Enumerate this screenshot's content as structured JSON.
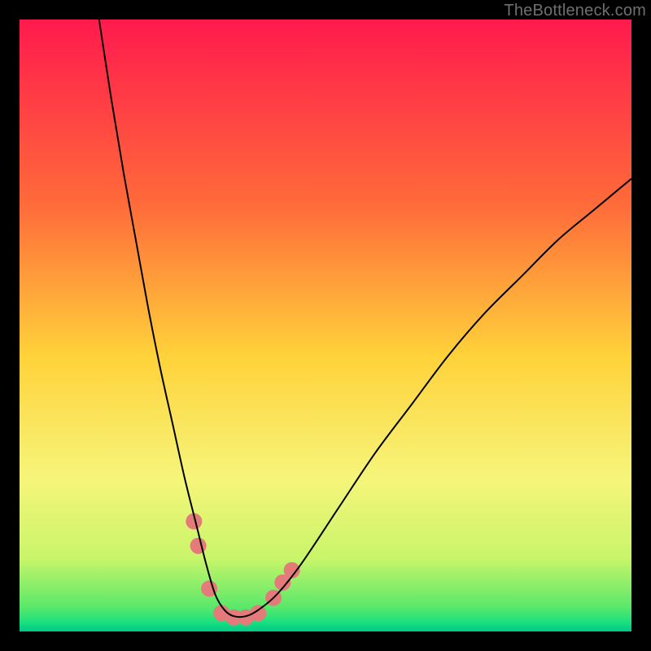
{
  "watermark": "TheBottleneck.com",
  "chart_data": {
    "type": "line",
    "title": "",
    "xlabel": "",
    "ylabel": "",
    "xlim": [
      0,
      100
    ],
    "ylim": [
      0,
      100
    ],
    "gradient_stops": [
      {
        "offset": 0,
        "color": "#ff1a4d"
      },
      {
        "offset": 0.3,
        "color": "#ff6a3a"
      },
      {
        "offset": 0.55,
        "color": "#ffd23a"
      },
      {
        "offset": 0.75,
        "color": "#f6f57a"
      },
      {
        "offset": 0.88,
        "color": "#c9f56a"
      },
      {
        "offset": 0.96,
        "color": "#5be86a"
      },
      {
        "offset": 0.985,
        "color": "#19e07e"
      },
      {
        "offset": 1.0,
        "color": "#00c98a"
      }
    ],
    "series": [
      {
        "name": "bottleneck-curve",
        "color": "#000000",
        "stroke_width": 2,
        "x": [
          13,
          15,
          17,
          19,
          21,
          23,
          25,
          27,
          29,
          30.5,
          32,
          33.5,
          35,
          37,
          39,
          42,
          46,
          52,
          58,
          64,
          70,
          76,
          82,
          88,
          94,
          100
        ],
        "y": [
          100,
          87,
          75,
          64,
          53,
          43,
          34,
          25,
          17,
          11,
          6,
          3.5,
          2.5,
          2.5,
          3.5,
          6,
          11,
          20,
          29,
          37,
          45,
          52,
          58,
          64,
          69,
          74
        ]
      }
    ],
    "markers": {
      "name": "highlighted-points",
      "color": "#e47a7a",
      "radius": 10,
      "points": [
        {
          "x": 28.5,
          "y": 18
        },
        {
          "x": 29.2,
          "y": 14
        },
        {
          "x": 31.0,
          "y": 7
        },
        {
          "x": 33.0,
          "y": 3
        },
        {
          "x": 35.0,
          "y": 2.3
        },
        {
          "x": 37.0,
          "y": 2.3
        },
        {
          "x": 39.0,
          "y": 3
        },
        {
          "x": 41.5,
          "y": 5.5
        },
        {
          "x": 43.0,
          "y": 8
        },
        {
          "x": 44.5,
          "y": 10
        }
      ]
    }
  }
}
